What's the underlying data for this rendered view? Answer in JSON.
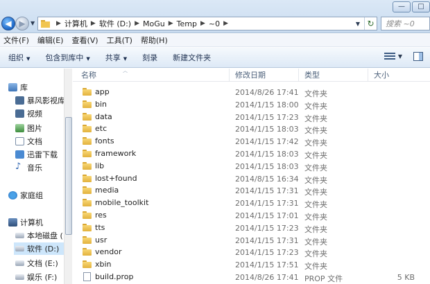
{
  "window_controls": {
    "minimize": "—",
    "maximize": "□",
    "close": "✕"
  },
  "nav": {
    "back_glyph": "◀",
    "forward_glyph": "▶"
  },
  "breadcrumbs": [
    "计算机",
    "软件 (D:)",
    "MoGu",
    "Temp",
    "~0"
  ],
  "search": {
    "placeholder": "搜索 ~0"
  },
  "menu": [
    "文件(F)",
    "编辑(E)",
    "查看(V)",
    "工具(T)",
    "帮助(H)"
  ],
  "toolbar": {
    "organize": "组织",
    "include_library": "包含到库中",
    "share": "共享",
    "burn": "刻录",
    "new_folder": "新建文件夹"
  },
  "sidebar": {
    "libraries": {
      "label": "库",
      "items": [
        "暴风影视库",
        "视频",
        "图片",
        "文档",
        "迅雷下载",
        "音乐"
      ]
    },
    "homegroup": "家庭组",
    "computer": {
      "label": "计算机",
      "items": [
        "本地磁盘 (",
        "软件 (D:)",
        "文档 (E:)",
        "娱乐 (F:)"
      ],
      "selected": "软件 (D:)"
    }
  },
  "columns": {
    "name": "名称",
    "date": "修改日期",
    "type": "类型",
    "size": "大小"
  },
  "files": [
    {
      "name": "app",
      "date": "2014/8/26 17:41",
      "type": "文件夹",
      "size": "",
      "kind": "folder"
    },
    {
      "name": "bin",
      "date": "2014/1/15 18:00",
      "type": "文件夹",
      "size": "",
      "kind": "folder"
    },
    {
      "name": "data",
      "date": "2014/1/15 17:23",
      "type": "文件夹",
      "size": "",
      "kind": "folder"
    },
    {
      "name": "etc",
      "date": "2014/1/15 18:03",
      "type": "文件夹",
      "size": "",
      "kind": "folder"
    },
    {
      "name": "fonts",
      "date": "2014/1/15 17:42",
      "type": "文件夹",
      "size": "",
      "kind": "folder"
    },
    {
      "name": "framework",
      "date": "2014/1/15 18:03",
      "type": "文件夹",
      "size": "",
      "kind": "folder"
    },
    {
      "name": "lib",
      "date": "2014/1/15 18:03",
      "type": "文件夹",
      "size": "",
      "kind": "folder"
    },
    {
      "name": "lost+found",
      "date": "2014/8/15 16:34",
      "type": "文件夹",
      "size": "",
      "kind": "folder"
    },
    {
      "name": "media",
      "date": "2014/1/15 17:31",
      "type": "文件夹",
      "size": "",
      "kind": "folder"
    },
    {
      "name": "mobile_toolkit",
      "date": "2014/1/15 17:31",
      "type": "文件夹",
      "size": "",
      "kind": "folder"
    },
    {
      "name": "res",
      "date": "2014/1/15 17:01",
      "type": "文件夹",
      "size": "",
      "kind": "folder"
    },
    {
      "name": "tts",
      "date": "2014/1/15 17:23",
      "type": "文件夹",
      "size": "",
      "kind": "folder"
    },
    {
      "name": "usr",
      "date": "2014/1/15 17:31",
      "type": "文件夹",
      "size": "",
      "kind": "folder"
    },
    {
      "name": "vendor",
      "date": "2014/1/15 17:23",
      "type": "文件夹",
      "size": "",
      "kind": "folder"
    },
    {
      "name": "xbin",
      "date": "2014/1/15 17:51",
      "type": "文件夹",
      "size": "",
      "kind": "folder"
    },
    {
      "name": "build.prop",
      "date": "2014/8/26 17:41",
      "type": "PROP 文件",
      "size": "5 KB",
      "kind": "file"
    }
  ]
}
